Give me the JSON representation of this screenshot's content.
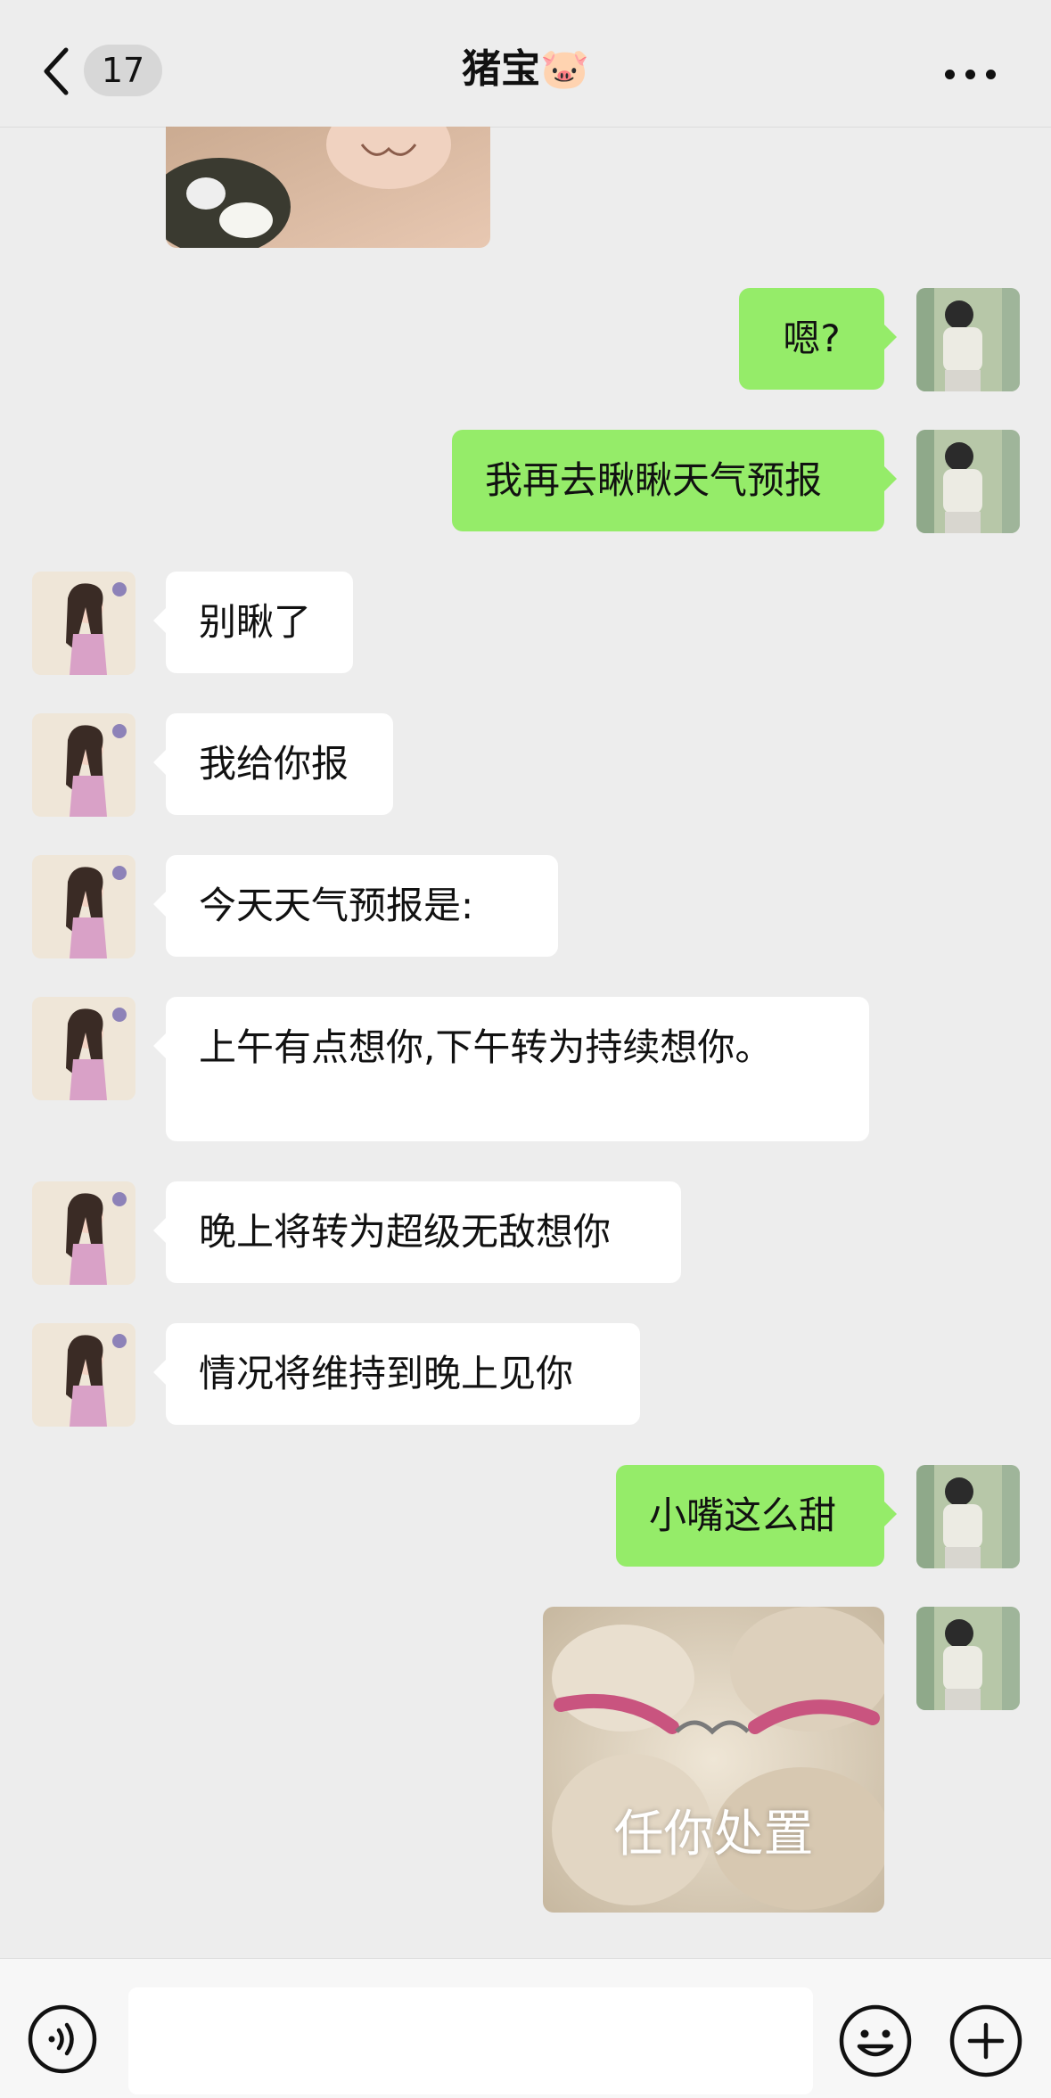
{
  "header": {
    "back_count": "17",
    "title": "猪宝🐷"
  },
  "messages": [
    {
      "type": "image",
      "side": "in",
      "content": "partial photo"
    },
    {
      "type": "text",
      "side": "out",
      "text": "嗯?"
    },
    {
      "type": "text",
      "side": "out",
      "text": "我再去瞅瞅天气预报"
    },
    {
      "type": "text",
      "side": "in",
      "text": "别瞅了"
    },
    {
      "type": "text",
      "side": "in",
      "text": "我给你报"
    },
    {
      "type": "text",
      "side": "in",
      "text": "今天天气预报是:"
    },
    {
      "type": "text",
      "side": "in",
      "text": "上午有点想你,下午转为持续想你。"
    },
    {
      "type": "text",
      "side": "in",
      "text": "晚上将转为超级无敌想你"
    },
    {
      "type": "text",
      "side": "in",
      "text": "情况将维持到晚上见你"
    },
    {
      "type": "text",
      "side": "out",
      "text": "小嘴这么甜"
    },
    {
      "type": "sticker",
      "side": "out",
      "caption": "任你处置"
    }
  ],
  "icons": {
    "back": "chevron-left-icon",
    "more": "more-dots-icon",
    "voice": "voice-icon",
    "emoji": "emoji-icon",
    "plus": "plus-icon"
  },
  "colors": {
    "background": "#ededed",
    "outgoing_bubble": "#95ec69",
    "incoming_bubble": "#ffffff"
  }
}
